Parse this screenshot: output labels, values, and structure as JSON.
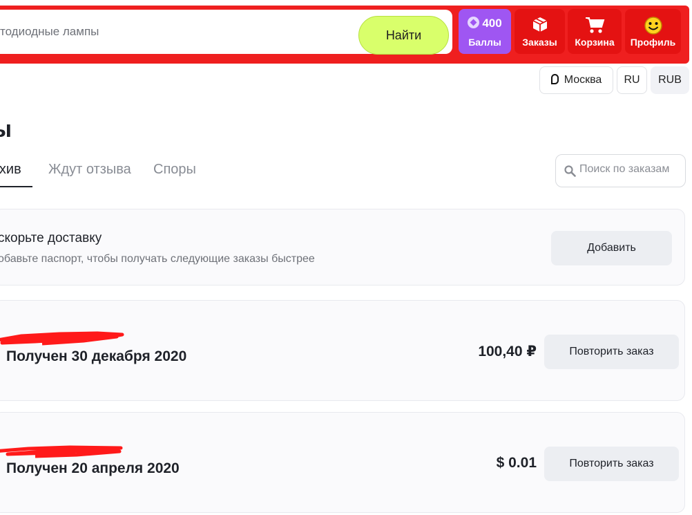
{
  "header": {
    "search_text": "тодиодные лампы",
    "find_label": "Найти",
    "points_value": "400",
    "points_label": "Баллы",
    "orders_label": "Заказы",
    "cart_label": "Корзина",
    "profile_label": "Профиль"
  },
  "subheader": {
    "city": "Москва",
    "language": "RU",
    "currency": "RUB"
  },
  "page": {
    "title": "ы"
  },
  "tabs": [
    {
      "label": "рхив",
      "active": true
    },
    {
      "label": "Ждут отзыва",
      "active": false
    },
    {
      "label": "Споры",
      "active": false
    }
  ],
  "order_search": {
    "placeholder": "Поиск по заказам"
  },
  "promo": {
    "title": "скорьте доставку",
    "subtitle": "обавьте паспорт, чтобы получать следующие заказы быстрее",
    "button": "Добавить"
  },
  "orders": [
    {
      "status": "Получен 30 декабря 2020",
      "price": "100,40 ₽",
      "button": "Повторить заказ"
    },
    {
      "status": "Получен 20 апреля 2020",
      "price": "$ 0.01",
      "button": "Повторить заказ"
    }
  ],
  "colors": {
    "header_red": "#ef1f1f",
    "find_button": "#d9ff6b",
    "points_purple": "#9f56f2",
    "redaction": "#ff1a1a"
  }
}
